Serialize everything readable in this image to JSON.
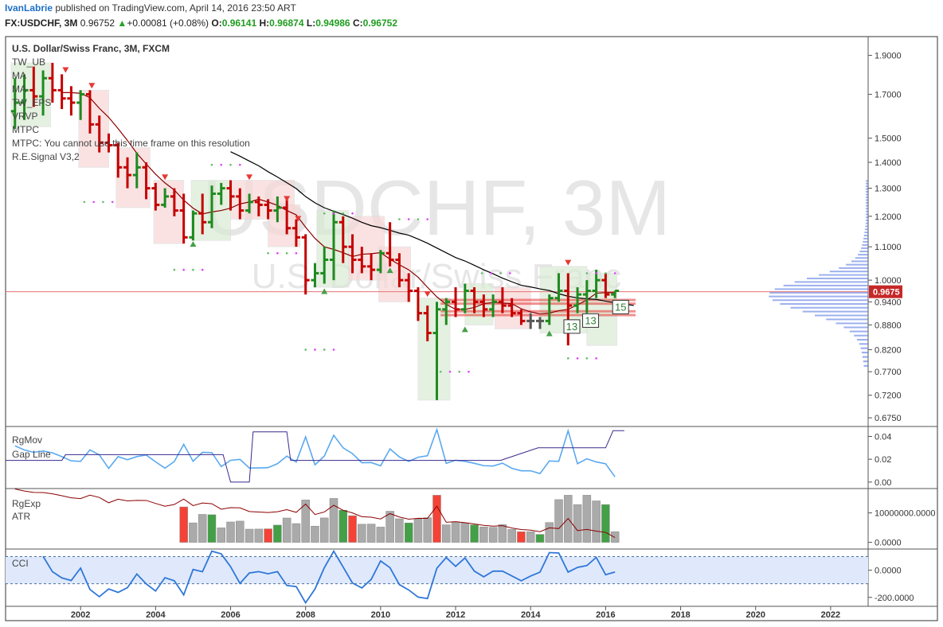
{
  "header": {
    "user": "IvanLabrie",
    "published": "published on TradingView.com, April 14, 2016 23:50 ART",
    "symbol": "FX:USDCHF, 3M",
    "price": "0.96752",
    "change": "+0.00081 (+0.08%)",
    "o_label": "O:",
    "o_value": "0.96141",
    "h_label": "H:",
    "h_value": "0.96874",
    "l_label": "L:",
    "l_value": "0.94986",
    "c_label": "C:",
    "c_value": "0.96752"
  },
  "watermark": {
    "big": "USDCHF, 3M",
    "small": "U.S. Dollar/Swiss Franc"
  },
  "main_pane": {
    "title": "U.S. Dollar/Swiss Franc, 3M, FXCM",
    "indicators": [
      "TW_UB",
      "MA",
      "MA",
      "TW_EPS",
      "VRVP",
      "MTPC",
      "MTPC: You cannot use this time frame on this resolution",
      "R.E.Signal V3,2"
    ]
  },
  "pane2": {
    "labels": [
      "RgMov",
      "Gap Line"
    ]
  },
  "pane3": {
    "labels": [
      "RgExp",
      "ATR"
    ]
  },
  "pane4": {
    "labels": [
      "CCI"
    ]
  },
  "colors": {
    "up": "#1f8a1f",
    "down": "#c40000",
    "neutral": "#555555",
    "ma": "#8b0000",
    "ma_long": "#000000",
    "line": "#5aa9f0",
    "cci": "#2f77d9",
    "price_tag": "#c62828",
    "vp": "#4a6fe0"
  },
  "chart_data": [
    {
      "type": "candlestick",
      "title": "U.S. Dollar/Swiss Franc, 3M, FXCM",
      "x_ticks": [
        "2002",
        "2004",
        "2006",
        "2008",
        "2010",
        "2012",
        "2014",
        "2016",
        "2018",
        "2020",
        "2022"
      ],
      "x_range": [
        2000.0,
        2023.0
      ],
      "y_scale": "log",
      "y_ticks": [
        "1.9000",
        "1.7000",
        "1.5000",
        "1.4000",
        "1.3000",
        "1.2000",
        "1.1000",
        "1.0000",
        "0.9400",
        "0.8800",
        "0.8200",
        "0.7700",
        "0.7200",
        "0.6750"
      ],
      "y_range": [
        0.66,
        2.0
      ],
      "last_price_label": "0.9675",
      "markers": [
        "13",
        "13",
        "15"
      ],
      "bars": [
        {
          "t": 2000.25,
          "o": 1.62,
          "h": 1.78,
          "l": 1.54,
          "c": 1.66
        },
        {
          "t": 2000.5,
          "o": 1.66,
          "h": 1.8,
          "l": 1.58,
          "c": 1.72
        },
        {
          "t": 2000.75,
          "o": 1.72,
          "h": 1.84,
          "l": 1.64,
          "c": 1.69
        },
        {
          "t": 2001.0,
          "o": 1.69,
          "h": 1.82,
          "l": 1.6,
          "c": 1.78
        },
        {
          "t": 2001.25,
          "o": 1.78,
          "h": 1.86,
          "l": 1.66,
          "c": 1.72
        },
        {
          "t": 2001.5,
          "o": 1.72,
          "h": 1.8,
          "l": 1.63,
          "c": 1.68
        },
        {
          "t": 2001.75,
          "o": 1.68,
          "h": 1.74,
          "l": 1.6,
          "c": 1.66
        },
        {
          "t": 2002.0,
          "o": 1.66,
          "h": 1.72,
          "l": 1.58,
          "c": 1.7
        },
        {
          "t": 2002.25,
          "o": 1.7,
          "h": 1.72,
          "l": 1.52,
          "c": 1.56
        },
        {
          "t": 2002.5,
          "o": 1.56,
          "h": 1.6,
          "l": 1.44,
          "c": 1.48
        },
        {
          "t": 2002.75,
          "o": 1.48,
          "h": 1.52,
          "l": 1.44,
          "c": 1.47
        },
        {
          "t": 2003.0,
          "o": 1.47,
          "h": 1.48,
          "l": 1.34,
          "c": 1.38
        },
        {
          "t": 2003.25,
          "o": 1.38,
          "h": 1.42,
          "l": 1.3,
          "c": 1.35
        },
        {
          "t": 2003.5,
          "o": 1.35,
          "h": 1.44,
          "l": 1.3,
          "c": 1.38
        },
        {
          "t": 2003.75,
          "o": 1.38,
          "h": 1.4,
          "l": 1.26,
          "c": 1.3
        },
        {
          "t": 2004.0,
          "o": 1.3,
          "h": 1.32,
          "l": 1.22,
          "c": 1.24
        },
        {
          "t": 2004.25,
          "o": 1.24,
          "h": 1.3,
          "l": 1.23,
          "c": 1.27
        },
        {
          "t": 2004.5,
          "o": 1.27,
          "h": 1.3,
          "l": 1.2,
          "c": 1.22
        },
        {
          "t": 2004.75,
          "o": 1.22,
          "h": 1.28,
          "l": 1.11,
          "c": 1.13
        },
        {
          "t": 2005.0,
          "o": 1.13,
          "h": 1.22,
          "l": 1.12,
          "c": 1.21
        },
        {
          "t": 2005.25,
          "o": 1.21,
          "h": 1.28,
          "l": 1.14,
          "c": 1.18
        },
        {
          "t": 2005.5,
          "o": 1.18,
          "h": 1.31,
          "l": 1.16,
          "c": 1.28
        },
        {
          "t": 2005.75,
          "o": 1.28,
          "h": 1.32,
          "l": 1.24,
          "c": 1.3
        },
        {
          "t": 2006.0,
          "o": 1.3,
          "h": 1.33,
          "l": 1.22,
          "c": 1.27
        },
        {
          "t": 2006.25,
          "o": 1.27,
          "h": 1.3,
          "l": 1.19,
          "c": 1.22
        },
        {
          "t": 2006.5,
          "o": 1.22,
          "h": 1.28,
          "l": 1.21,
          "c": 1.25
        },
        {
          "t": 2006.75,
          "o": 1.25,
          "h": 1.27,
          "l": 1.2,
          "c": 1.24
        },
        {
          "t": 2007.0,
          "o": 1.24,
          "h": 1.26,
          "l": 1.19,
          "c": 1.22
        },
        {
          "t": 2007.25,
          "o": 1.22,
          "h": 1.27,
          "l": 1.18,
          "c": 1.23
        },
        {
          "t": 2007.5,
          "o": 1.23,
          "h": 1.26,
          "l": 1.14,
          "c": 1.16
        },
        {
          "t": 2007.75,
          "o": 1.16,
          "h": 1.19,
          "l": 1.1,
          "c": 1.13
        },
        {
          "t": 2008.0,
          "o": 1.13,
          "h": 1.14,
          "l": 0.96,
          "c": 1.0
        },
        {
          "t": 2008.25,
          "o": 1.0,
          "h": 1.05,
          "l": 0.98,
          "c": 1.02
        },
        {
          "t": 2008.5,
          "o": 1.02,
          "h": 1.1,
          "l": 0.99,
          "c": 1.06
        },
        {
          "t": 2008.75,
          "o": 1.06,
          "h": 1.22,
          "l": 1.0,
          "c": 1.18
        },
        {
          "t": 2009.0,
          "o": 1.18,
          "h": 1.2,
          "l": 1.05,
          "c": 1.1
        },
        {
          "t": 2009.25,
          "o": 1.1,
          "h": 1.14,
          "l": 1.02,
          "c": 1.06
        },
        {
          "t": 2009.5,
          "o": 1.06,
          "h": 1.1,
          "l": 1.02,
          "c": 1.04
        },
        {
          "t": 2009.75,
          "o": 1.04,
          "h": 1.08,
          "l": 1.0,
          "c": 1.03
        },
        {
          "t": 2010.0,
          "o": 1.03,
          "h": 1.09,
          "l": 1.02,
          "c": 1.08
        },
        {
          "t": 2010.25,
          "o": 1.08,
          "h": 1.18,
          "l": 1.04,
          "c": 1.06
        },
        {
          "t": 2010.5,
          "o": 1.06,
          "h": 1.08,
          "l": 0.98,
          "c": 1.0
        },
        {
          "t": 2010.75,
          "o": 1.0,
          "h": 1.02,
          "l": 0.94,
          "c": 0.97
        },
        {
          "t": 2011.0,
          "o": 0.97,
          "h": 0.98,
          "l": 0.89,
          "c": 0.91
        },
        {
          "t": 2011.25,
          "o": 0.91,
          "h": 0.93,
          "l": 0.84,
          "c": 0.86
        },
        {
          "t": 2011.5,
          "o": 0.86,
          "h": 0.94,
          "l": 0.71,
          "c": 0.92
        },
        {
          "t": 2011.75,
          "o": 0.92,
          "h": 0.95,
          "l": 0.88,
          "c": 0.94
        },
        {
          "t": 2012.0,
          "o": 0.94,
          "h": 0.98,
          "l": 0.9,
          "c": 0.92
        },
        {
          "t": 2012.25,
          "o": 0.92,
          "h": 0.99,
          "l": 0.91,
          "c": 0.97
        },
        {
          "t": 2012.5,
          "o": 0.97,
          "h": 0.98,
          "l": 0.91,
          "c": 0.94
        },
        {
          "t": 2012.75,
          "o": 0.94,
          "h": 0.96,
          "l": 0.9,
          "c": 0.92
        },
        {
          "t": 2013.0,
          "o": 0.92,
          "h": 0.96,
          "l": 0.9,
          "c": 0.94
        },
        {
          "t": 2013.25,
          "o": 0.94,
          "h": 0.98,
          "l": 0.91,
          "c": 0.93
        },
        {
          "t": 2013.5,
          "o": 0.93,
          "h": 0.95,
          "l": 0.9,
          "c": 0.91
        },
        {
          "t": 2013.75,
          "o": 0.91,
          "h": 0.92,
          "l": 0.88,
          "c": 0.89
        },
        {
          "t": 2014.0,
          "o": 0.89,
          "h": 0.91,
          "l": 0.87,
          "c": 0.89
        },
        {
          "t": 2014.25,
          "o": 0.89,
          "h": 0.9,
          "l": 0.87,
          "c": 0.89
        },
        {
          "t": 2014.5,
          "o": 0.89,
          "h": 0.96,
          "l": 0.88,
          "c": 0.95
        },
        {
          "t": 2014.75,
          "o": 0.95,
          "h": 1.02,
          "l": 0.94,
          "c": 0.97
        },
        {
          "t": 2015.0,
          "o": 0.97,
          "h": 1.02,
          "l": 0.83,
          "c": 0.93
        },
        {
          "t": 2015.25,
          "o": 0.93,
          "h": 0.98,
          "l": 0.91,
          "c": 0.96
        },
        {
          "t": 2015.5,
          "o": 0.96,
          "h": 1.0,
          "l": 0.91,
          "c": 0.97
        },
        {
          "t": 2015.75,
          "o": 0.97,
          "h": 1.03,
          "l": 0.95,
          "c": 1.0
        },
        {
          "t": 2016.0,
          "o": 1.0,
          "h": 1.02,
          "l": 0.95,
          "c": 0.96
        },
        {
          "t": 2016.25,
          "o": 0.96,
          "h": 0.97,
          "l": 0.95,
          "c": 0.97
        }
      ]
    },
    {
      "type": "line",
      "series": [
        {
          "name": "RgMov"
        },
        {
          "name": "Gap Line"
        }
      ],
      "y_ticks": [
        "0.04",
        "0.02",
        "0.00"
      ],
      "y_range": [
        -0.005,
        0.048
      ]
    },
    {
      "type": "bar",
      "series": [
        {
          "name": "RgExp"
        },
        {
          "name": "ATR"
        }
      ],
      "y_ticks": [
        "10000000.0000",
        "0.0000"
      ],
      "y_range": [
        -2000000,
        18000000
      ]
    },
    {
      "type": "line",
      "series": [
        {
          "name": "CCI"
        }
      ],
      "y_ticks": [
        "0.0000",
        "-200.0000"
      ],
      "y_range": [
        -260,
        150
      ]
    }
  ]
}
